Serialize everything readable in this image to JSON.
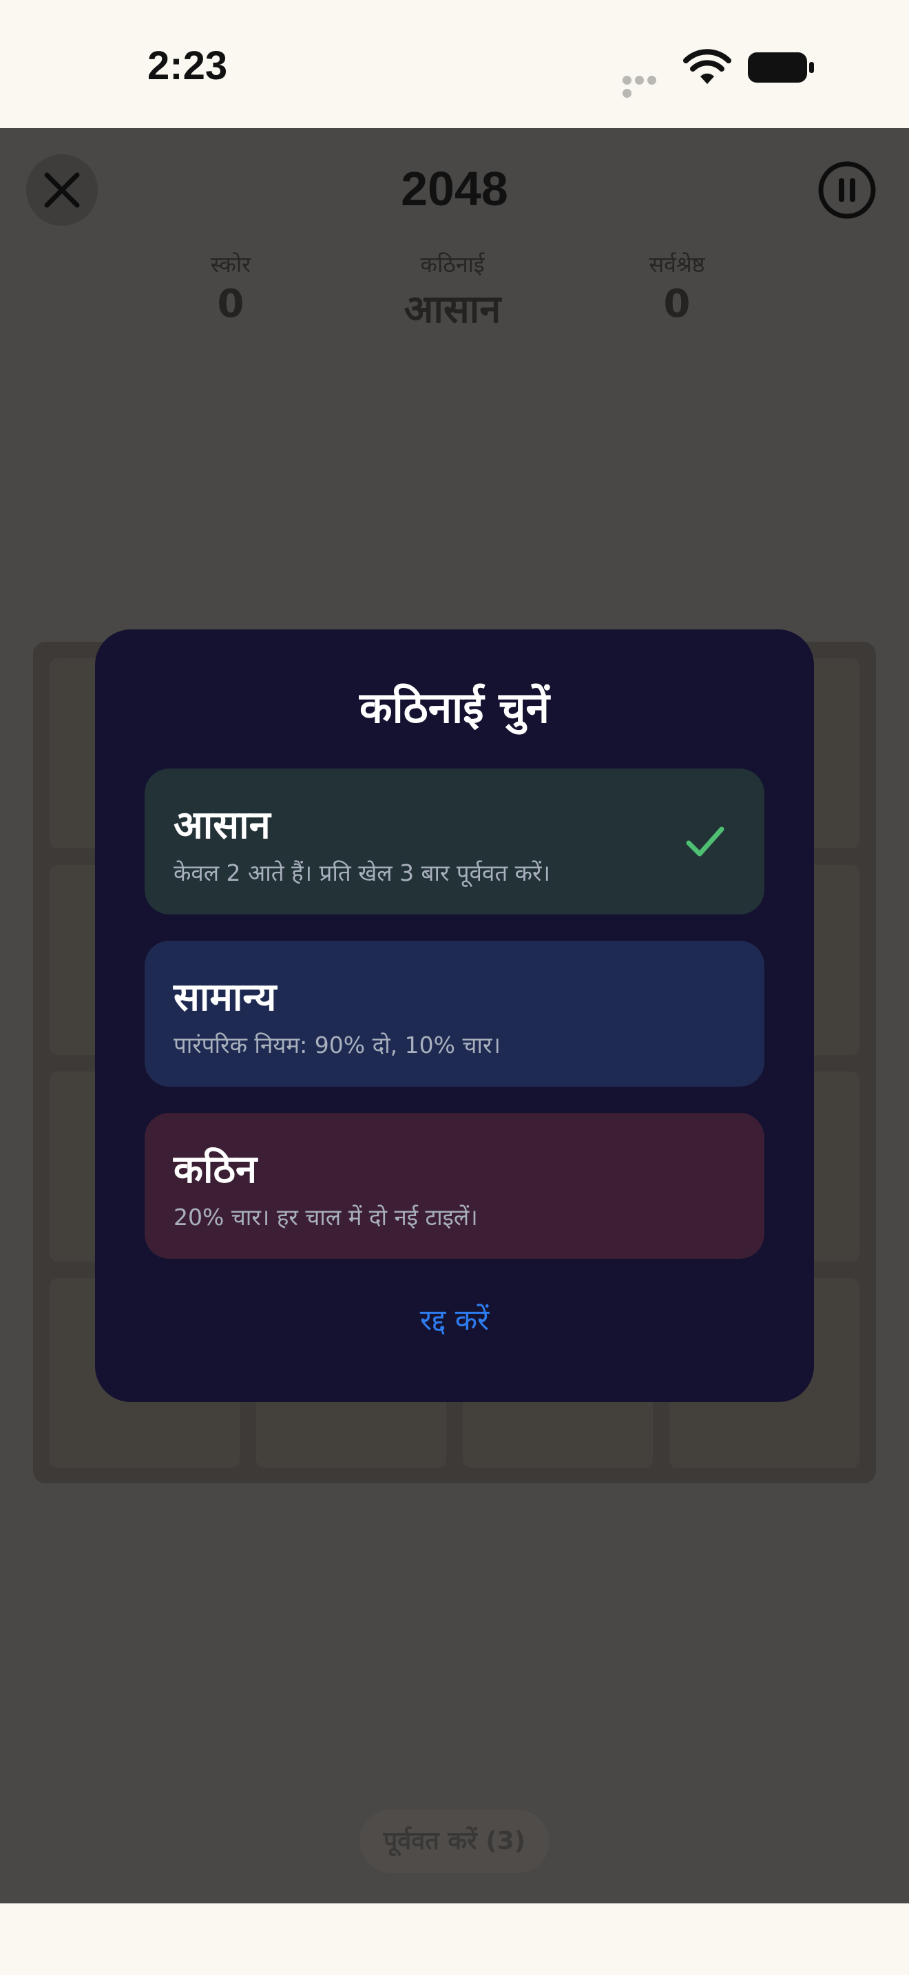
{
  "status_bar": {
    "time": "2:23"
  },
  "game": {
    "title": "2048",
    "stats": {
      "score_label": "स्कोर",
      "score_value": "0",
      "difficulty_label": "कठिनाई",
      "difficulty_value": "आसान",
      "best_label": "सर्वश्रेष्ठ",
      "best_value": "0"
    },
    "undo_label": "पूर्ववत करें (3)"
  },
  "modal": {
    "title": "कठिनाई चुनें",
    "options": [
      {
        "name": "आसान",
        "description": "केवल 2 आते हैं। प्रति खेल 3 बार पूर्ववत करें।",
        "selected": true
      },
      {
        "name": "सामान्य",
        "description": "पारंपरिक नियम: 90% दो, 10% चार।",
        "selected": false
      },
      {
        "name": "कठिन",
        "description": "20% चार। हर चाल में दो नई टाइलें।",
        "selected": false
      }
    ],
    "cancel_label": "रद्द करें"
  },
  "colors": {
    "accent_blue": "#2e7df0",
    "check_green": "#4fbf72",
    "modal_bg": "#141230",
    "easy_bg": "#223237",
    "normal_bg": "#1f2a52",
    "hard_bg": "#3c1f35"
  }
}
